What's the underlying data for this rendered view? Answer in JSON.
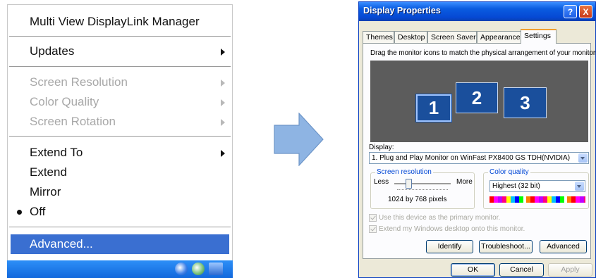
{
  "menu": {
    "title": "Multi View DisplayLink Manager",
    "items": [
      {
        "label": "Updates"
      },
      {
        "label": "Screen Resolution"
      },
      {
        "label": "Color Quality"
      },
      {
        "label": "Screen Rotation"
      },
      {
        "label": "Extend To"
      },
      {
        "label": "Extend"
      },
      {
        "label": "Mirror"
      },
      {
        "label": "Off"
      },
      {
        "label": "Advanced..."
      }
    ]
  },
  "dialog": {
    "title": "Display Properties",
    "help_glyph": "?",
    "close_glyph": "X",
    "tabs": [
      "Themes",
      "Desktop",
      "Screen Saver",
      "Appearance",
      "Settings"
    ],
    "instruction": "Drag the monitor icons to match the physical arrangement of your monitors.",
    "monitors": [
      "1",
      "2",
      "3"
    ],
    "display_label": "Display:",
    "display_value": "1. Plug and Play Monitor on WinFast PX8400 GS TDH(NVIDIA)",
    "resolution": {
      "label": "Screen resolution",
      "less": "Less",
      "more": "More",
      "value": "1024 by 768 pixels",
      "slider_level": 0.25
    },
    "color": {
      "label": "Color quality",
      "value": "Highest (32 bit)"
    },
    "checkboxes": [
      {
        "label": "Use this device as the primary monitor.",
        "checked": true
      },
      {
        "label": "Extend my Windows desktop onto this monitor.",
        "checked": true
      }
    ],
    "buttons": {
      "identify": "Identify",
      "troubleshoot": "Troubleshoot...",
      "advanced": "Advanced",
      "ok": "OK",
      "cancel": "Cancel",
      "apply": "Apply"
    }
  },
  "colors": {
    "highlight": "#3a6fd1",
    "arrow": "#8eb4e3",
    "monitor_fill": "#1a4f9c",
    "titlebar": "#0a5ce0"
  }
}
